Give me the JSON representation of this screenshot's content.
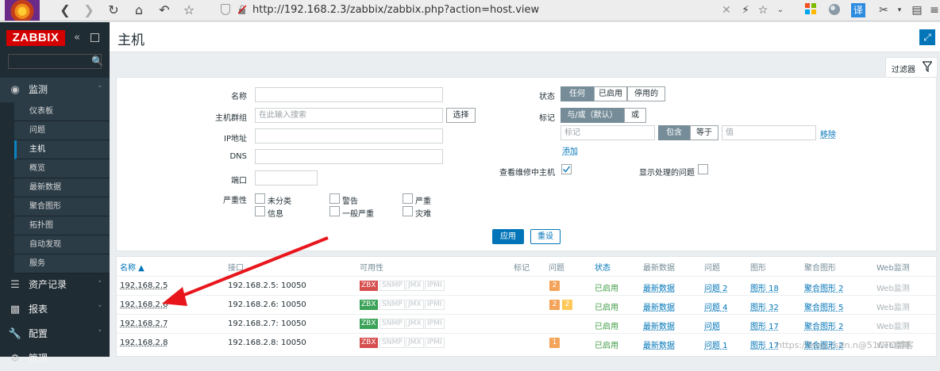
{
  "browser": {
    "url": "http://192.168.2.3/zabbix/zabbix.php?action=host.view",
    "translate_label": "译"
  },
  "sidebar": {
    "logo": "ZABBIX",
    "search_placeholder": "",
    "monitoring_label": "监测",
    "sub_items": [
      "仪表板",
      "问题",
      "主机",
      "概览",
      "最新数据",
      "聚合图形",
      "拓扑图",
      "自动发现",
      "服务"
    ],
    "active_sub": "主机",
    "inventory_label": "资产记录",
    "reports_label": "报表",
    "config_label": "配置",
    "admin_label": "管理"
  },
  "header": {
    "title": "主机"
  },
  "filter": {
    "tab_label": "过滤器",
    "name_label": "名称",
    "name_value": "",
    "hostgroups_label": "主机群组",
    "hostgroups_placeholder": "在此输入搜索",
    "select_btn": "选择",
    "ip_label": "IP地址",
    "dns_label": "DNS",
    "port_label": "端口",
    "severity_label": "严重性",
    "severities": [
      "未分类",
      "信息",
      "警告",
      "一般严重",
      "严重",
      "灾难"
    ],
    "status_label": "状态",
    "status_options": [
      "任何",
      "已启用",
      "停用的"
    ],
    "tags_label": "标记",
    "tag_mode_options": [
      "与/或（默认）",
      "或"
    ],
    "tag_placeholder": "标记",
    "tag_op_options": [
      "包含",
      "等于"
    ],
    "value_placeholder": "值",
    "remove_link": "移除",
    "add_link": "添加",
    "maint_label": "查看维修中主机",
    "maint_checked": true,
    "suppressed_label": "显示处理的问题",
    "suppressed_checked": false,
    "apply_btn": "应用",
    "reset_btn": "重设"
  },
  "table": {
    "headers": [
      "名称 ▲",
      "接口",
      "可用性",
      "标记",
      "问题",
      "状态",
      "最新数据",
      "问题",
      "图形",
      "聚合图形",
      "Web监测"
    ],
    "rows": [
      {
        "name": "192.168.2.5",
        "iface": "192.168.2.5: 10050",
        "zbx": "red",
        "problems": [
          "2"
        ],
        "status": "已启用",
        "latest": "最新数据",
        "prob_link": "问题 2",
        "graphs": "图形 18",
        "screens": "聚合图形 2",
        "web": "Web监测"
      },
      {
        "name": "192.168.2.6",
        "iface": "192.168.2.6: 10050",
        "zbx": "green",
        "problems": [
          "2",
          "2"
        ],
        "status": "已启用",
        "latest": "最新数据",
        "prob_link": "问题 4",
        "graphs": "图形 32",
        "screens": "聚合图形 5",
        "web": "Web监测"
      },
      {
        "name": "192.168.2.7",
        "iface": "192.168.2.7: 10050",
        "zbx": "green",
        "problems": [],
        "status": "已启用",
        "latest": "最新数据",
        "prob_link": "问题",
        "graphs": "图形 17",
        "screens": "聚合图形 2",
        "web": "Web监测"
      },
      {
        "name": "192.168.2.8",
        "iface": "192.168.2.8: 10050",
        "zbx": "red",
        "problems": [
          "1"
        ],
        "status": "已启用",
        "latest": "最新数据",
        "prob_link": "问题 1",
        "graphs": "图形 17",
        "screens": "聚合图形 2",
        "web": "Web监测"
      }
    ],
    "avail_labels": [
      "ZBX",
      "SNMP",
      "JMX",
      "IPMI"
    ]
  },
  "watermark": "https://blog.csdn.n@51CTO博客",
  "colors": {
    "accent": "#0275b8",
    "sidebar": "#1f2c33",
    "enabled": "#429e47",
    "logo": "#d40000",
    "arrow": "#e8161c"
  }
}
